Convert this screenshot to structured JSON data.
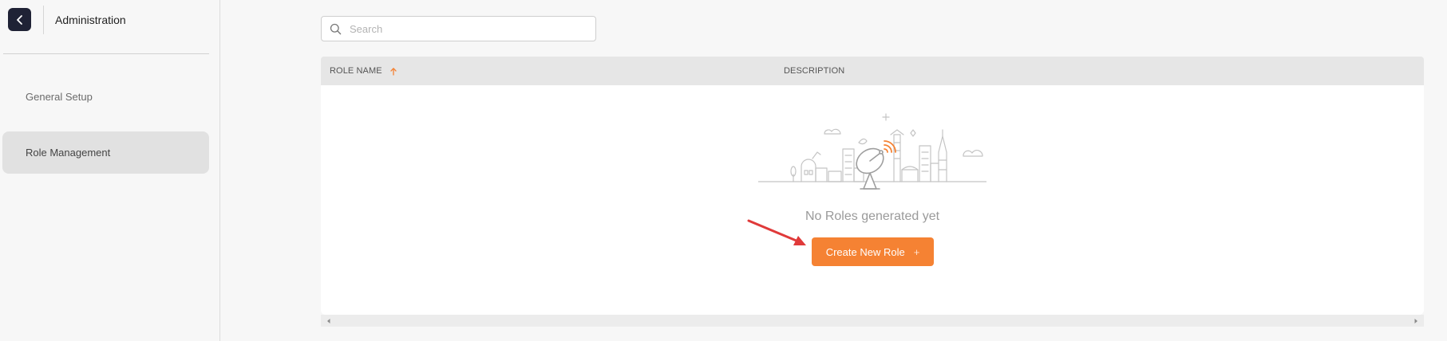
{
  "header": {
    "back_icon": "chevron-left-icon",
    "title": "Administration"
  },
  "sidebar": {
    "items": [
      {
        "label": "General Setup",
        "active": false
      },
      {
        "label": "Role Management",
        "active": true
      }
    ]
  },
  "search": {
    "placeholder": "Search",
    "value": "",
    "icon": "search-icon"
  },
  "table": {
    "columns": [
      {
        "label": "ROLE NAME",
        "sort": "ascending",
        "sort_icon": "arrow-up-icon"
      },
      {
        "label": "DESCRIPTION"
      }
    ],
    "rows": [],
    "empty_message": "No Roles generated yet",
    "create_button": {
      "label": "Create New Role",
      "icon": "+"
    }
  },
  "colors": {
    "accent": "#f58233",
    "back_button_bg": "#1f2235",
    "active_nav_bg": "#e1e1e1",
    "annotation_arrow": "#e03a3a"
  }
}
